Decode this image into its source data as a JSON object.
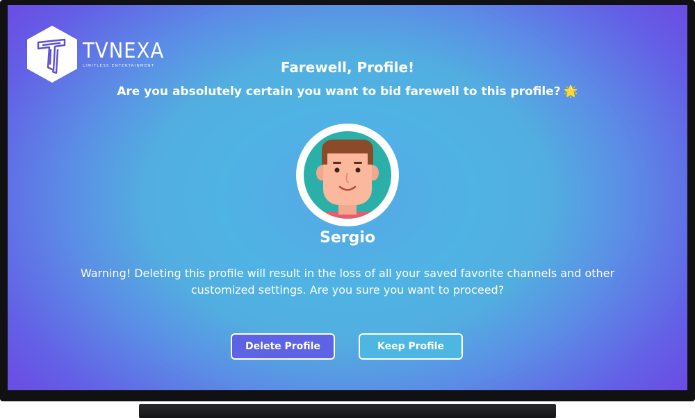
{
  "brand": {
    "name": "TVNEXA",
    "tagline": "LIMITLESS ENTERTAINMENT"
  },
  "dialog": {
    "title": "Farewell, Profile!",
    "subtitle": "Are you absolutely certain you want to bid farewell to this profile?",
    "subtitle_emoji": "🌟",
    "warning": "Warning! Deleting this profile will result in the loss of all your saved favorite channels and other customized settings. Are you sure you want to proceed?"
  },
  "profile": {
    "name": "Sergio",
    "avatar_icon": "cartoon-man-avatar"
  },
  "actions": {
    "delete_label": "Delete Profile",
    "keep_label": "Keep Profile"
  },
  "colors": {
    "delete_button": "#5e63e5",
    "keep_button": "#4db6e2",
    "avatar_background": "#2ab0a8",
    "accent_star": "#f7c64a"
  }
}
